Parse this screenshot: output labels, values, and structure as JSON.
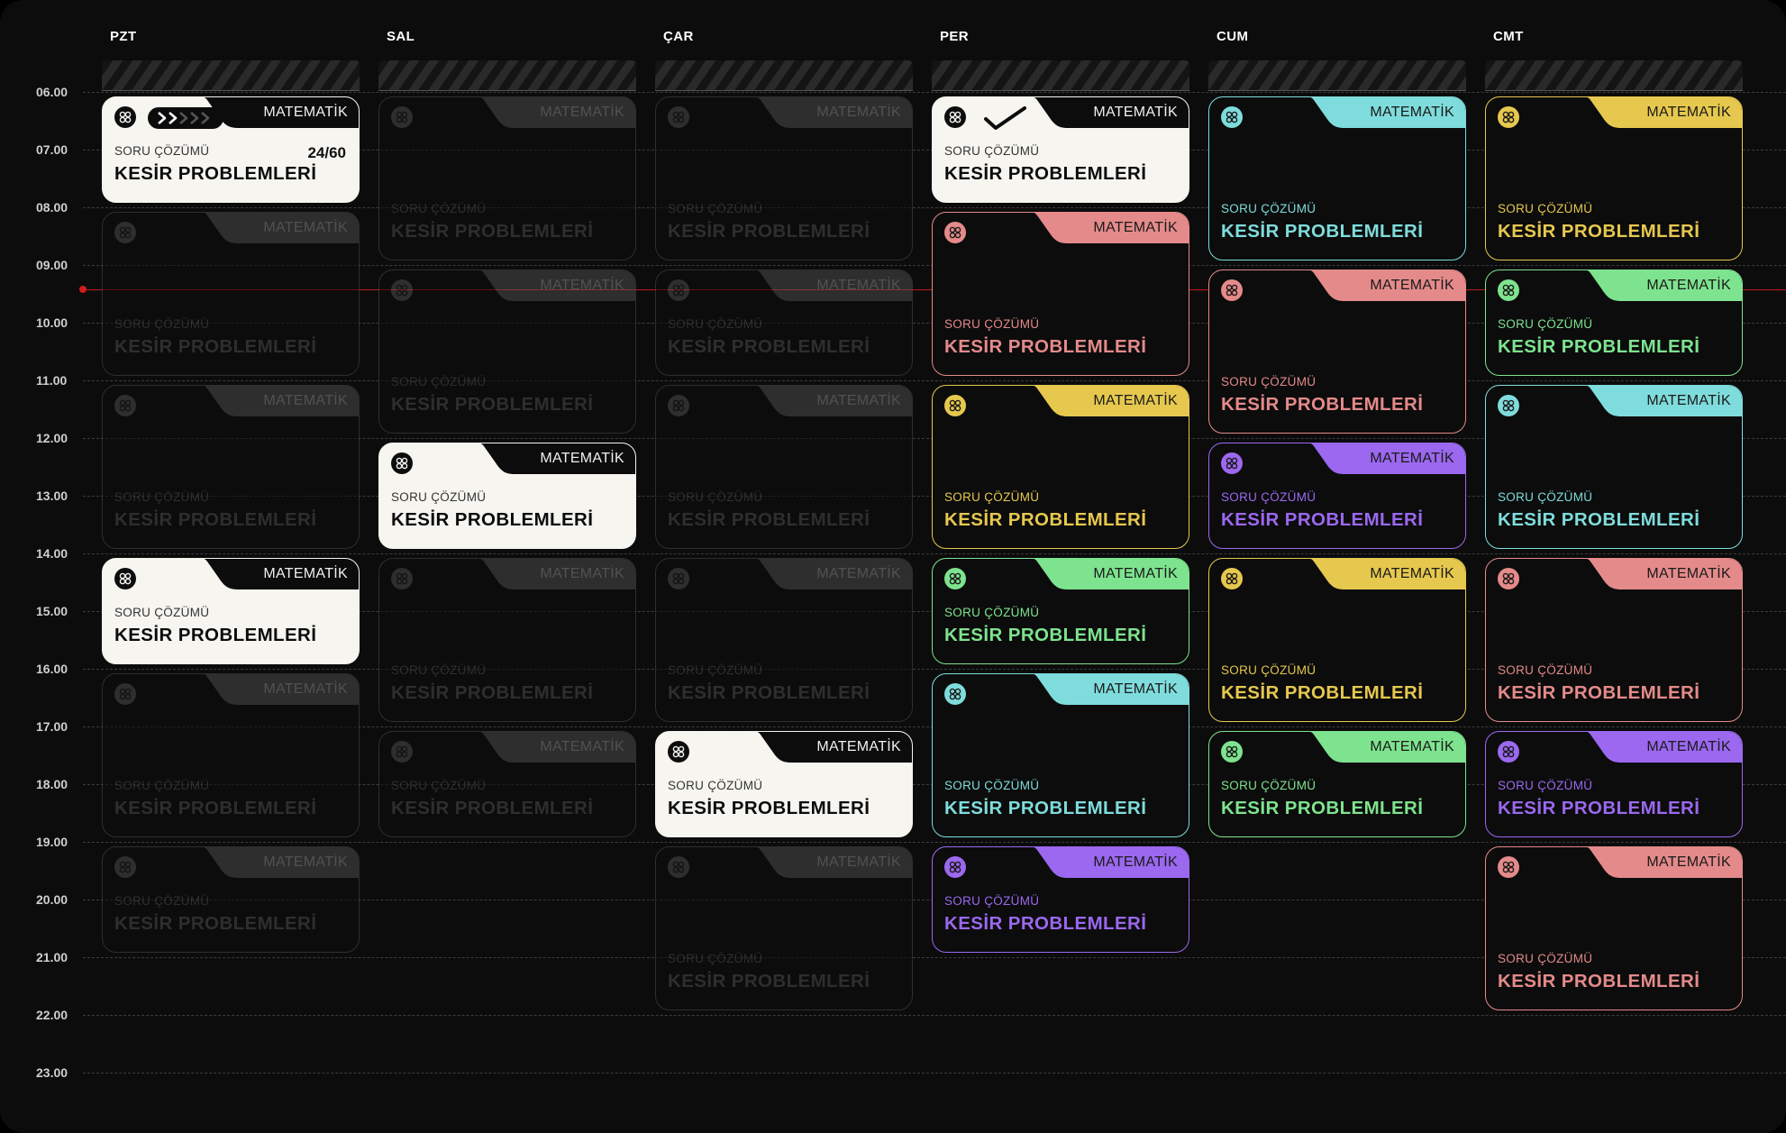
{
  "days": [
    "PZT",
    "SAL",
    "ÇAR",
    "PER",
    "CUM",
    "CMT"
  ],
  "hours": [
    "06.00",
    "07.00",
    "08.00",
    "09.00",
    "10.00",
    "11.00",
    "12.00",
    "13.00",
    "14.00",
    "15.00",
    "16.00",
    "17.00",
    "18.00",
    "19.00",
    "20.00",
    "21.00",
    "22.00",
    "23.00"
  ],
  "current_time": "09.25",
  "colors": {
    "inactive": "#4a4a4a",
    "filled": "#f6f5f0",
    "coral": "#e58a8a",
    "yellow": "#e6c84e",
    "green": "#7ee38e",
    "cyan": "#7fdcdc",
    "purple": "#9b68ef"
  },
  "events": [
    {
      "day": 0,
      "start": "06.05",
      "end": "07.55",
      "subject": "MATEMATİK",
      "kind": "SORU ÇÖZÜMÜ",
      "title": "KESİR PROBLEMLERİ",
      "style": "filled",
      "progress": "24/60",
      "progress_fraction": 0.4,
      "icon": "double-chevron-progress-icon"
    },
    {
      "day": 0,
      "start": "08.05",
      "end": "10.55",
      "subject": "MATEMATİK",
      "kind": "SORU ÇÖZÜMÜ",
      "title": "KESİR PROBLEMLERİ",
      "style": "inactive"
    },
    {
      "day": 0,
      "start": "11.05",
      "end": "13.55",
      "subject": "MATEMATİK",
      "kind": "SORU ÇÖZÜMÜ",
      "title": "KESİR PROBLEMLERİ",
      "style": "inactive"
    },
    {
      "day": 0,
      "start": "14.05",
      "end": "15.55",
      "subject": "MATEMATİK",
      "kind": "SORU ÇÖZÜMÜ",
      "title": "KESİR PROBLEMLERİ",
      "style": "filled"
    },
    {
      "day": 0,
      "start": "16.05",
      "end": "18.55",
      "subject": "MATEMATİK",
      "kind": "SORU ÇÖZÜMÜ",
      "title": "KESİR PROBLEMLERİ",
      "style": "inactive"
    },
    {
      "day": 0,
      "start": "19.05",
      "end": "20.55",
      "subject": "MATEMATİK",
      "kind": "SORU ÇÖZÜMÜ",
      "title": "KESİR PROBLEMLERİ",
      "style": "inactive"
    },
    {
      "day": 1,
      "start": "06.05",
      "end": "08.55",
      "subject": "MATEMATİK",
      "kind": "SORU ÇÖZÜMÜ",
      "title": "KESİR PROBLEMLERİ",
      "style": "inactive"
    },
    {
      "day": 1,
      "start": "09.05",
      "end": "11.55",
      "subject": "MATEMATİK",
      "kind": "SORU ÇÖZÜMÜ",
      "title": "KESİR PROBLEMLERİ",
      "style": "inactive"
    },
    {
      "day": 1,
      "start": "12.05",
      "end": "13.55",
      "subject": "MATEMATİK",
      "kind": "SORU ÇÖZÜMÜ",
      "title": "KESİR PROBLEMLERİ",
      "style": "filled"
    },
    {
      "day": 1,
      "start": "14.05",
      "end": "16.55",
      "subject": "MATEMATİK",
      "kind": "SORU ÇÖZÜMÜ",
      "title": "KESİR PROBLEMLERİ",
      "style": "inactive"
    },
    {
      "day": 1,
      "start": "17.05",
      "end": "18.55",
      "subject": "MATEMATİK",
      "kind": "SORU ÇÖZÜMÜ",
      "title": "KESİR PROBLEMLERİ",
      "style": "inactive"
    },
    {
      "day": 2,
      "start": "06.05",
      "end": "08.55",
      "subject": "MATEMATİK",
      "kind": "SORU ÇÖZÜMÜ",
      "title": "KESİR PROBLEMLERİ",
      "style": "inactive"
    },
    {
      "day": 2,
      "start": "09.05",
      "end": "10.55",
      "subject": "MATEMATİK",
      "kind": "SORU ÇÖZÜMÜ",
      "title": "KESİR PROBLEMLERİ",
      "style": "inactive"
    },
    {
      "day": 2,
      "start": "11.05",
      "end": "13.55",
      "subject": "MATEMATİK",
      "kind": "SORU ÇÖZÜMÜ",
      "title": "KESİR PROBLEMLERİ",
      "style": "inactive"
    },
    {
      "day": 2,
      "start": "14.05",
      "end": "16.55",
      "subject": "MATEMATİK",
      "kind": "SORU ÇÖZÜMÜ",
      "title": "KESİR PROBLEMLERİ",
      "style": "inactive"
    },
    {
      "day": 2,
      "start": "17.05",
      "end": "18.55",
      "subject": "MATEMATİK",
      "kind": "SORU ÇÖZÜMÜ",
      "title": "KESİR PROBLEMLERİ",
      "style": "filled"
    },
    {
      "day": 2,
      "start": "19.05",
      "end": "21.55",
      "subject": "MATEMATİK",
      "kind": "SORU ÇÖZÜMÜ",
      "title": "KESİR PROBLEMLERİ",
      "style": "inactive"
    },
    {
      "day": 3,
      "start": "06.05",
      "end": "07.55",
      "subject": "MATEMATİK",
      "kind": "SORU ÇÖZÜMÜ",
      "title": "KESİR PROBLEMLERİ",
      "style": "filled",
      "icon": "check-icon"
    },
    {
      "day": 3,
      "start": "08.05",
      "end": "10.55",
      "subject": "MATEMATİK",
      "kind": "SORU ÇÖZÜMÜ",
      "title": "KESİR PROBLEMLERİ",
      "style": "coral"
    },
    {
      "day": 3,
      "start": "11.05",
      "end": "13.55",
      "subject": "MATEMATİK",
      "kind": "SORU ÇÖZÜMÜ",
      "title": "KESİR PROBLEMLERİ",
      "style": "yellow"
    },
    {
      "day": 3,
      "start": "14.05",
      "end": "15.55",
      "subject": "MATEMATİK",
      "kind": "SORU ÇÖZÜMÜ",
      "title": "KESİR PROBLEMLERİ",
      "style": "green"
    },
    {
      "day": 3,
      "start": "16.05",
      "end": "18.55",
      "subject": "MATEMATİK",
      "kind": "SORU ÇÖZÜMÜ",
      "title": "KESİR PROBLEMLERİ",
      "style": "cyan"
    },
    {
      "day": 3,
      "start": "19.05",
      "end": "20.55",
      "subject": "MATEMATİK",
      "kind": "SORU ÇÖZÜMÜ",
      "title": "KESİR PROBLEMLERİ",
      "style": "purple"
    },
    {
      "day": 4,
      "start": "06.05",
      "end": "08.55",
      "subject": "MATEMATİK",
      "kind": "SORU ÇÖZÜMÜ",
      "title": "KESİR PROBLEMLERİ",
      "style": "cyan"
    },
    {
      "day": 4,
      "start": "09.05",
      "end": "11.55",
      "subject": "MATEMATİK",
      "kind": "SORU ÇÖZÜMÜ",
      "title": "KESİR PROBLEMLERİ",
      "style": "coral"
    },
    {
      "day": 4,
      "start": "12.05",
      "end": "13.55",
      "subject": "MATEMATİK",
      "kind": "SORU ÇÖZÜMÜ",
      "title": "KESİR PROBLEMLERİ",
      "style": "purple"
    },
    {
      "day": 4,
      "start": "14.05",
      "end": "16.55",
      "subject": "MATEMATİK",
      "kind": "SORU ÇÖZÜMÜ",
      "title": "KESİR PROBLEMLERİ",
      "style": "yellow"
    },
    {
      "day": 4,
      "start": "17.05",
      "end": "18.55",
      "subject": "MATEMATİK",
      "kind": "SORU ÇÖZÜMÜ",
      "title": "KESİR PROBLEMLERİ",
      "style": "green"
    },
    {
      "day": 5,
      "start": "06.05",
      "end": "08.55",
      "subject": "MATEMATİK",
      "kind": "SORU ÇÖZÜMÜ",
      "title": "KESİR PROBLEMLERİ",
      "style": "yellow"
    },
    {
      "day": 5,
      "start": "09.05",
      "end": "10.55",
      "subject": "MATEMATİK",
      "kind": "SORU ÇÖZÜMÜ",
      "title": "KESİR PROBLEMLERİ",
      "style": "green"
    },
    {
      "day": 5,
      "start": "11.05",
      "end": "13.55",
      "subject": "MATEMATİK",
      "kind": "SORU ÇÖZÜMÜ",
      "title": "KESİR PROBLEMLERİ",
      "style": "cyan"
    },
    {
      "day": 5,
      "start": "14.05",
      "end": "16.55",
      "subject": "MATEMATİK",
      "kind": "SORU ÇÖZÜMÜ",
      "title": "KESİR PROBLEMLERİ",
      "style": "coral"
    },
    {
      "day": 5,
      "start": "17.05",
      "end": "18.55",
      "subject": "MATEMATİK",
      "kind": "SORU ÇÖZÜMÜ",
      "title": "KESİR PROBLEMLERİ",
      "style": "purple"
    },
    {
      "day": 5,
      "start": "19.05",
      "end": "21.55",
      "subject": "MATEMATİK",
      "kind": "SORU ÇÖZÜMÜ",
      "title": "KESİR PROBLEMLERİ",
      "style": "coral"
    }
  ]
}
